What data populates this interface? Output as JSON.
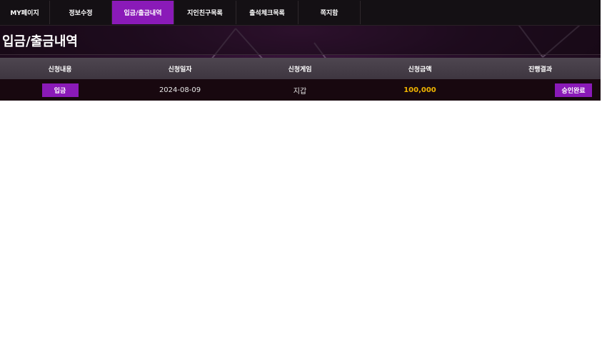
{
  "tabs": [
    {
      "label": "MY페이지"
    },
    {
      "label": "정보수정"
    },
    {
      "label": "입금/출금내역"
    },
    {
      "label": "지인친구목록"
    },
    {
      "label": "출석체크목록"
    },
    {
      "label": "쪽지함"
    }
  ],
  "active_tab": "입금/출금내역",
  "page_title": "입금/출금내역",
  "table": {
    "headers": [
      "신청내용",
      "신청일자",
      "신청게임",
      "신청금액",
      "진행결과"
    ],
    "rows": [
      {
        "type": "입금",
        "date": "2024-08-09",
        "game": "지갑",
        "amount": "100,000",
        "status": "승인완료"
      }
    ]
  },
  "colors": {
    "accent": "#8a1ab8",
    "amount": "#f0b400",
    "background": "#140812"
  }
}
